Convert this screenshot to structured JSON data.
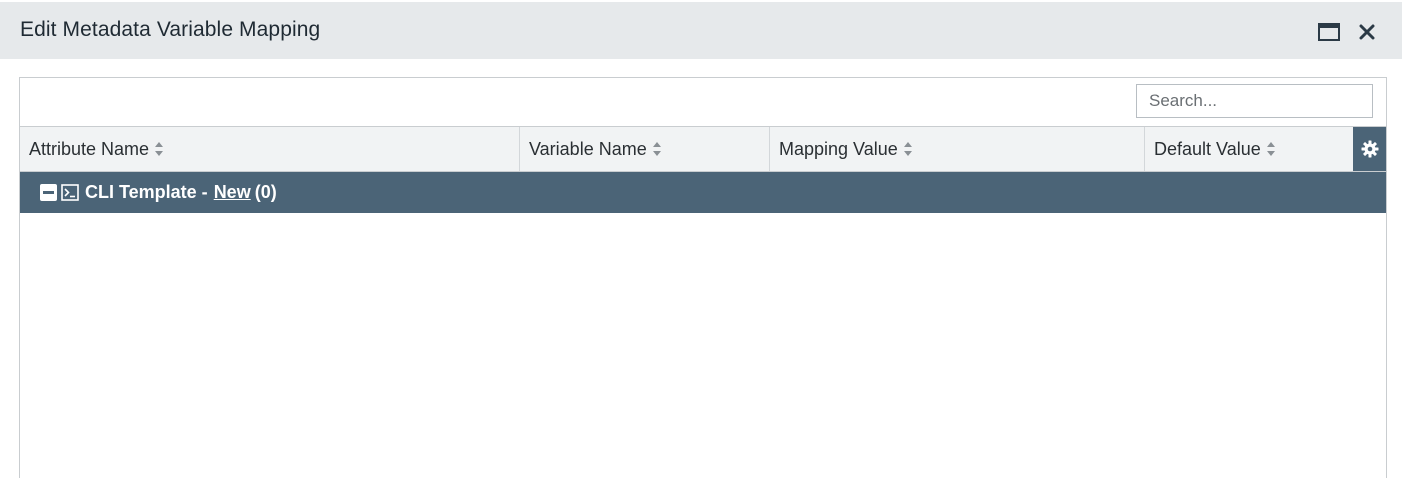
{
  "dialog": {
    "title": "Edit Metadata Variable Mapping"
  },
  "search": {
    "placeholder": "Search..."
  },
  "table": {
    "columns": [
      "Attribute Name",
      "Variable Name",
      "Mapping Value",
      "Default Value"
    ]
  },
  "group": {
    "title": "CLI Template -",
    "new_label": "New",
    "count": "(0)"
  },
  "colors": {
    "titlebar_bg": "#e6e9eb",
    "header_bg": "#f1f3f4",
    "accent": "#4b6477"
  },
  "icons": {
    "maximize": "window-maximize-icon",
    "close": "close-icon",
    "sort": "sort-icon",
    "settings": "gear-icon",
    "collapse": "minus-square-icon",
    "terminal": "terminal-icon"
  }
}
